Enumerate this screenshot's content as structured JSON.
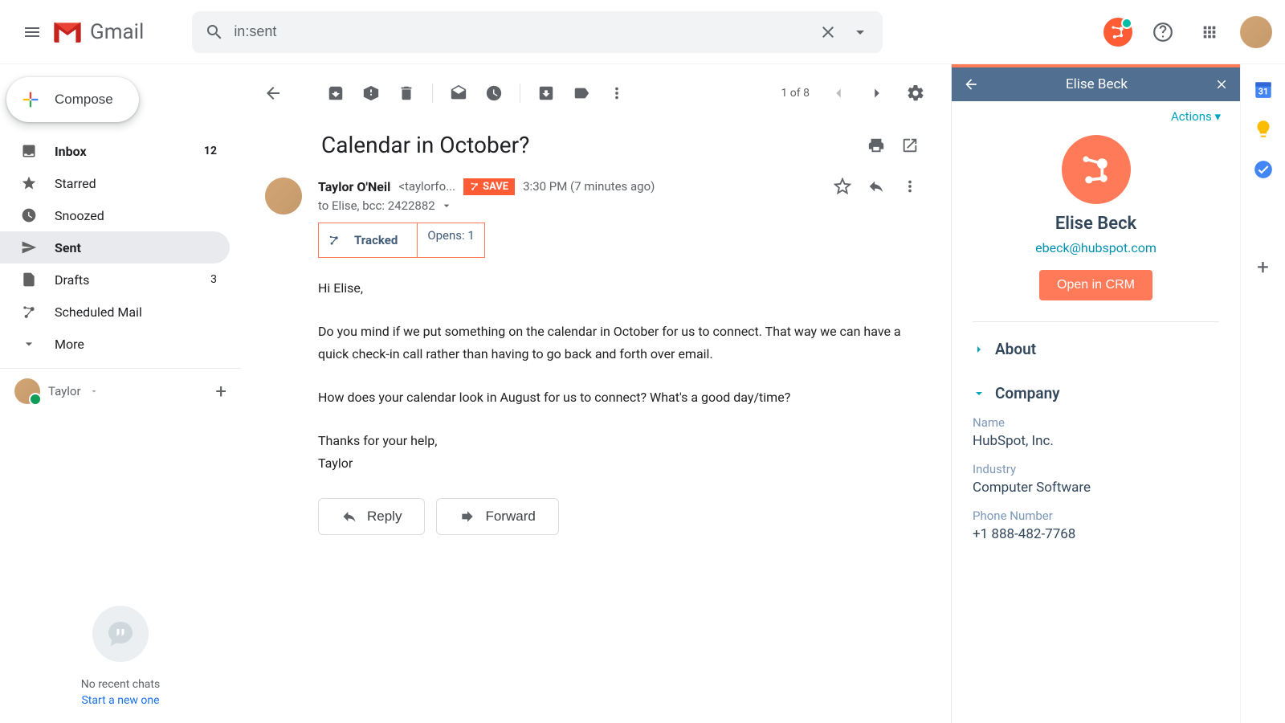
{
  "header": {
    "app_name": "Gmail",
    "search_value": "in:sent"
  },
  "sidebar": {
    "compose_label": "Compose",
    "items": [
      {
        "label": "Inbox",
        "count": "12",
        "bold": true
      },
      {
        "label": "Starred"
      },
      {
        "label": "Snoozed"
      },
      {
        "label": "Sent",
        "active": true
      },
      {
        "label": "Drafts",
        "count": "3"
      },
      {
        "label": "Scheduled Mail"
      },
      {
        "label": "More"
      }
    ],
    "user": "Taylor",
    "hangouts_empty": "No recent chats",
    "hangouts_link": "Start a new one"
  },
  "toolbar": {
    "pager": "1 of 8"
  },
  "email": {
    "subject": "Calendar in October?",
    "sender_name": "Taylor O'Neil",
    "sender_email": "<taylorfo...",
    "save_label": "SAVE",
    "time": "3:30 PM (7 minutes ago)",
    "recipients": "to Elise, bcc: 2422882",
    "tracked_label": "Tracked",
    "opens_label": "Opens: 1",
    "body_greeting": "Hi Elise,",
    "body_p1": "Do you mind if we put something on the calendar in October for us to connect. That way we can have a quick check-in call rather than having to go back and forth over email.",
    "body_p2": "How does your calendar look in August for us to connect? What's a good day/time?",
    "body_closing": "Thanks for your help,",
    "body_signature": "Taylor",
    "reply_label": "Reply",
    "forward_label": "Forward"
  },
  "hubspot": {
    "header_title": "Elise Beck",
    "actions_label": "Actions",
    "contact_name": "Elise Beck",
    "contact_email": "ebeck@hubspot.com",
    "open_crm_label": "Open in CRM",
    "about_label": "About",
    "company_label": "Company",
    "fields": {
      "name_lbl": "Name",
      "name_val": "HubSpot, Inc.",
      "industry_lbl": "Industry",
      "industry_val": "Computer Software",
      "phone_lbl": "Phone Number",
      "phone_val": "+1 888-482-7768"
    }
  }
}
